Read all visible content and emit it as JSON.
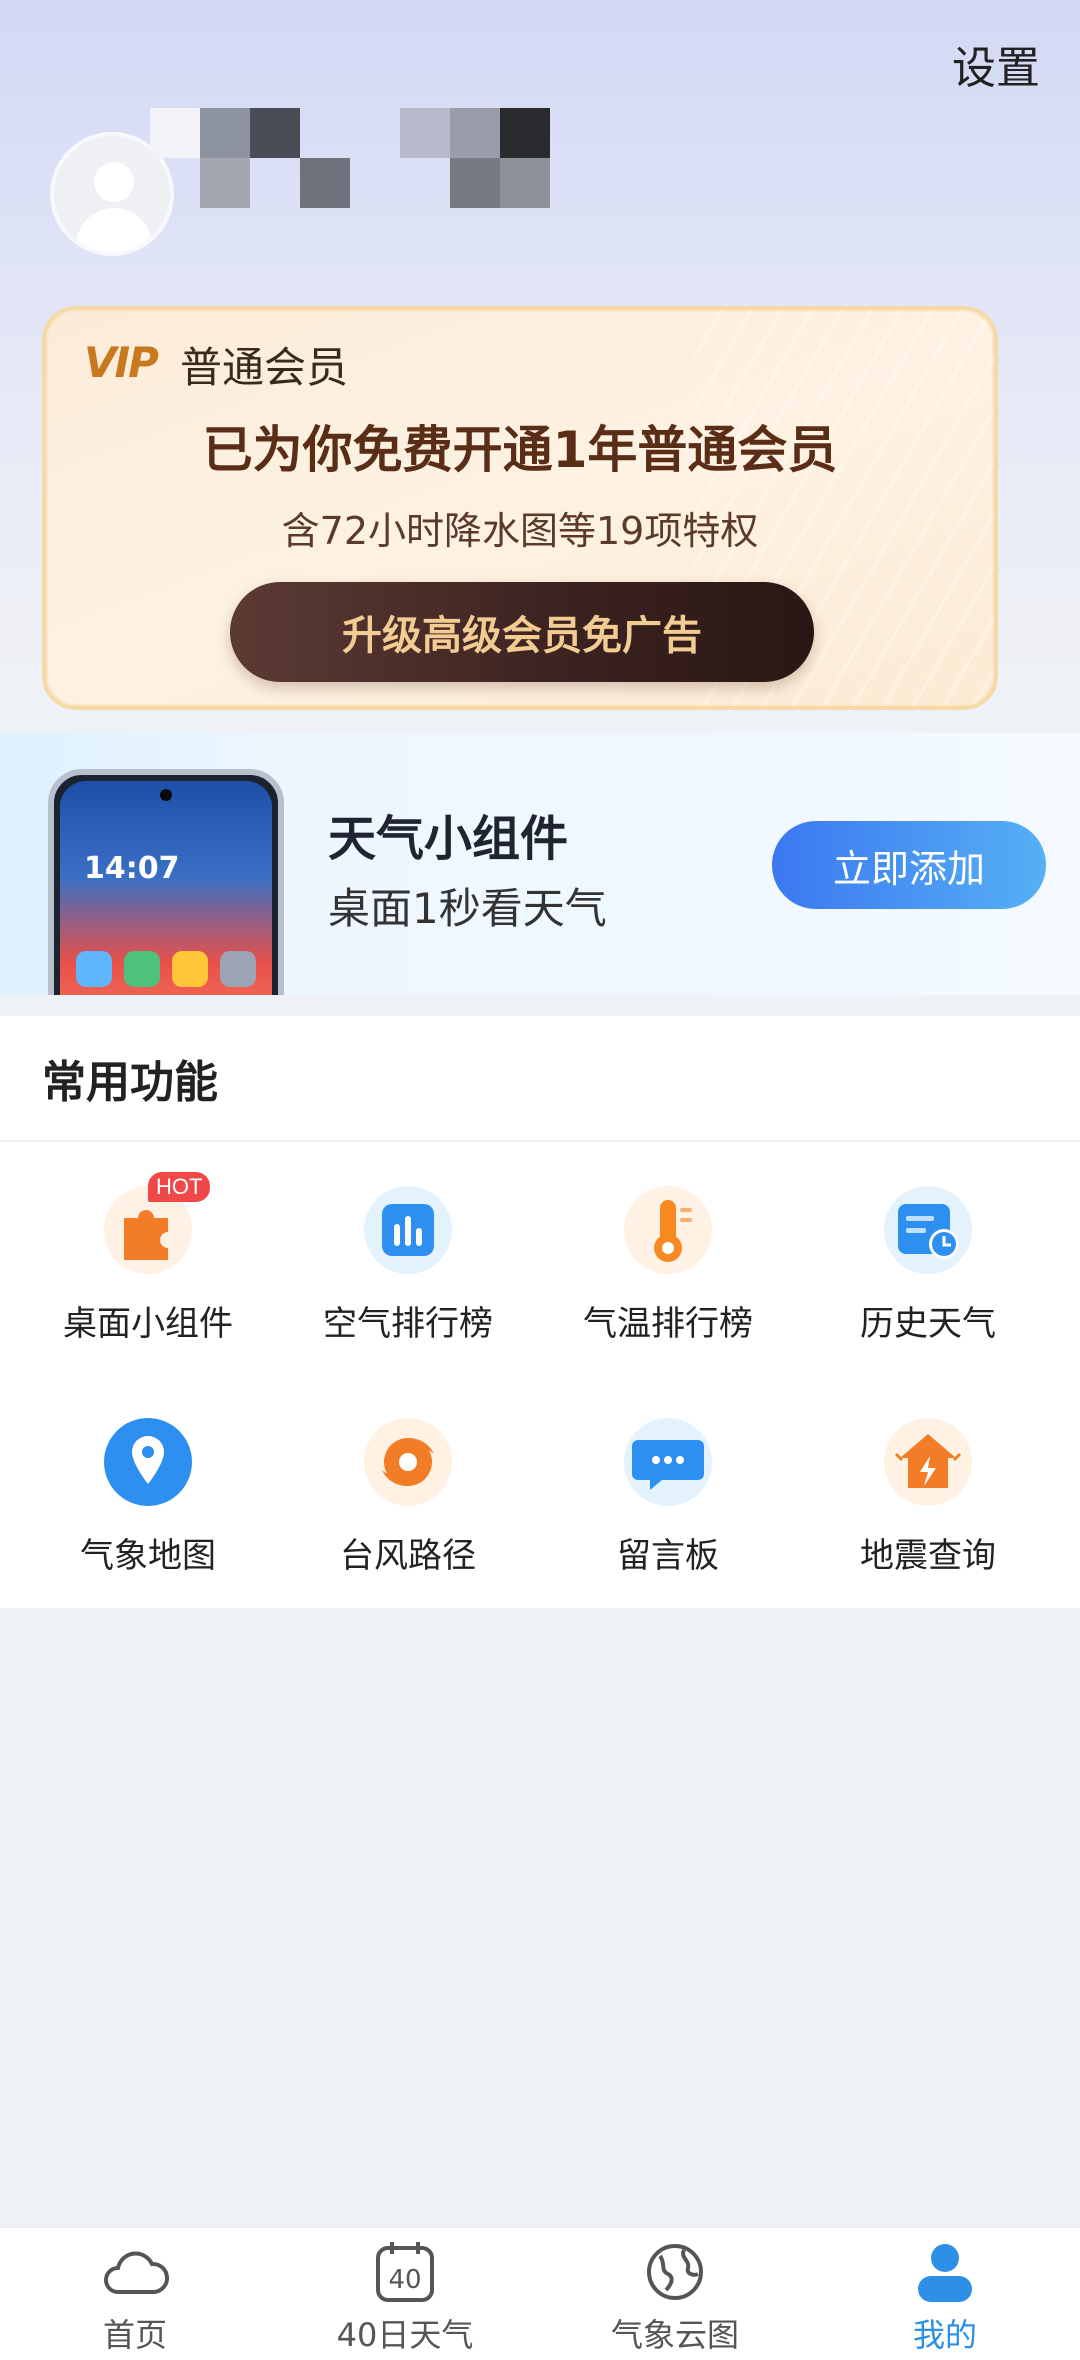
{
  "header": {
    "settings_label": "设置"
  },
  "profile": {
    "avatar_icon": "default-avatar-icon",
    "username_obscured": true
  },
  "vip": {
    "logo": "VIP",
    "level": "普通会员",
    "title": "已为你免费开通1年普通会员",
    "subtitle": "含72小时降水图等19项特权",
    "button_label": "升级高级会员免广告"
  },
  "widget_banner": {
    "phone_time": "14:07",
    "title": "天气小组件",
    "subtitle": "桌面1秒看天气",
    "button_label": "立即添加"
  },
  "features": {
    "section_title": "常用功能",
    "hot_badge": "HOT",
    "items": [
      {
        "label": "桌面小组件",
        "icon": "puzzle-icon"
      },
      {
        "label": "空气排行榜",
        "icon": "bar-chart-icon"
      },
      {
        "label": "气温排行榜",
        "icon": "thermometer-icon"
      },
      {
        "label": "历史天气",
        "icon": "calendar-clock-icon"
      },
      {
        "label": "气象地图",
        "icon": "map-pin-icon"
      },
      {
        "label": "台风路径",
        "icon": "typhoon-icon"
      },
      {
        "label": "留言板",
        "icon": "message-icon"
      },
      {
        "label": "地震查询",
        "icon": "earthquake-icon"
      }
    ]
  },
  "tabbar": {
    "items": [
      {
        "label": "首页",
        "icon": "cloud-icon"
      },
      {
        "label": "40日天气",
        "icon": "calendar-40-icon",
        "icon_text": "40"
      },
      {
        "label": "气象云图",
        "icon": "globe-icon"
      },
      {
        "label": "我的",
        "icon": "user-icon",
        "active": true
      }
    ]
  },
  "colors": {
    "accent_blue": "#2d8fe6",
    "vip_gold": "#f2cc92",
    "vip_dark": "#3a221f"
  }
}
